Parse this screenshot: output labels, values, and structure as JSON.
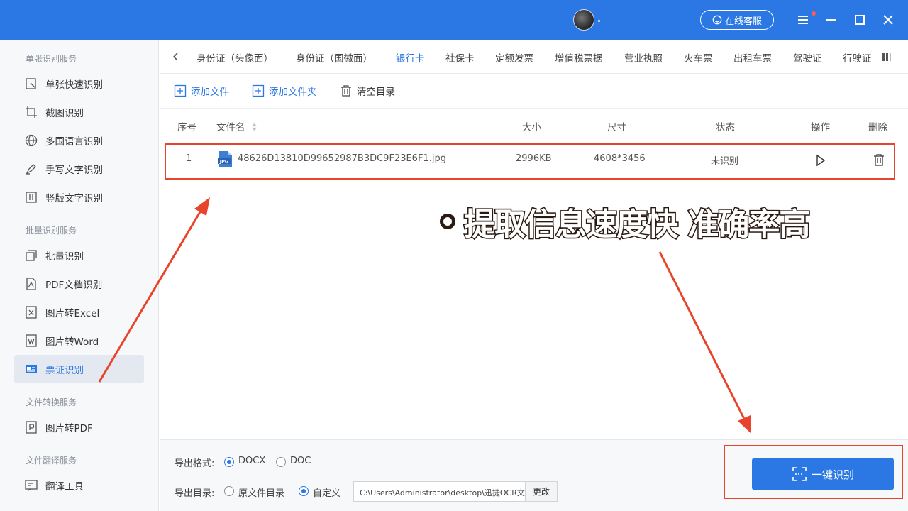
{
  "titlebar": {
    "support_label": "在线客服",
    "accent": "#2b78e4"
  },
  "sidebar": {
    "groups": [
      {
        "label": "单张识别服务"
      },
      {
        "label": "批量识别服务"
      },
      {
        "label": "文件转换服务"
      },
      {
        "label": "文件翻译服务"
      }
    ],
    "items": [
      {
        "label": "单张快速识别",
        "icon": "quick-scan-icon"
      },
      {
        "label": "截图识别",
        "icon": "crop-icon"
      },
      {
        "label": "多国语言识别",
        "icon": "globe-icon"
      },
      {
        "label": "手写文字识别",
        "icon": "pen-icon"
      },
      {
        "label": "竖版文字识别",
        "icon": "vertical-text-icon"
      },
      {
        "label": "批量识别",
        "icon": "batch-icon"
      },
      {
        "label": "PDF文档识别",
        "icon": "pdf-icon"
      },
      {
        "label": "图片转Excel",
        "icon": "excel-icon"
      },
      {
        "label": "图片转Word",
        "icon": "word-icon"
      },
      {
        "label": "票证识别",
        "icon": "ticket-icon",
        "active": true
      },
      {
        "label": "图片转PDF",
        "icon": "image-pdf-icon"
      },
      {
        "label": "翻译工具",
        "icon": "translate-icon"
      }
    ]
  },
  "tabs": [
    {
      "label": "身份证（头像面）"
    },
    {
      "label": "身份证（国徽面）"
    },
    {
      "label": "银行卡",
      "active": true
    },
    {
      "label": "社保卡"
    },
    {
      "label": "定额发票"
    },
    {
      "label": "增值税票据"
    },
    {
      "label": "营业执照"
    },
    {
      "label": "火车票"
    },
    {
      "label": "出租车票"
    },
    {
      "label": "驾驶证"
    },
    {
      "label": "行驶证"
    }
  ],
  "toolbar": {
    "add_file": "添加文件",
    "add_folder": "添加文件夹",
    "clear": "清空目录"
  },
  "table": {
    "headers": {
      "index": "序号",
      "filename": "文件名",
      "size": "大小",
      "dimension": "尺寸",
      "status": "状态",
      "action": "操作",
      "delete": "删除"
    },
    "rows": [
      {
        "index": "1",
        "filename": "48626D13810D99652987B3DC9F23E6F1.jpg",
        "file_type": "JPG",
        "size": "2996KB",
        "dimension": "4608*3456",
        "status": "未识别"
      }
    ]
  },
  "promo": {
    "text": "提取信息速度快 准确率高"
  },
  "footer": {
    "format_label": "导出格式:",
    "format_options": [
      "DOCX",
      "DOC"
    ],
    "format_selected": "DOCX",
    "dir_label": "导出目录:",
    "dir_options": [
      "原文件目录",
      "自定义"
    ],
    "dir_selected": "自定义",
    "path": "C:\\Users\\Administrator\\desktop\\迅捷OCR文",
    "change_label": "更改",
    "recognize_label": "一键识别"
  },
  "colors": {
    "highlight": "#e8442c",
    "sidebar_bg": "#f7f8fa"
  }
}
